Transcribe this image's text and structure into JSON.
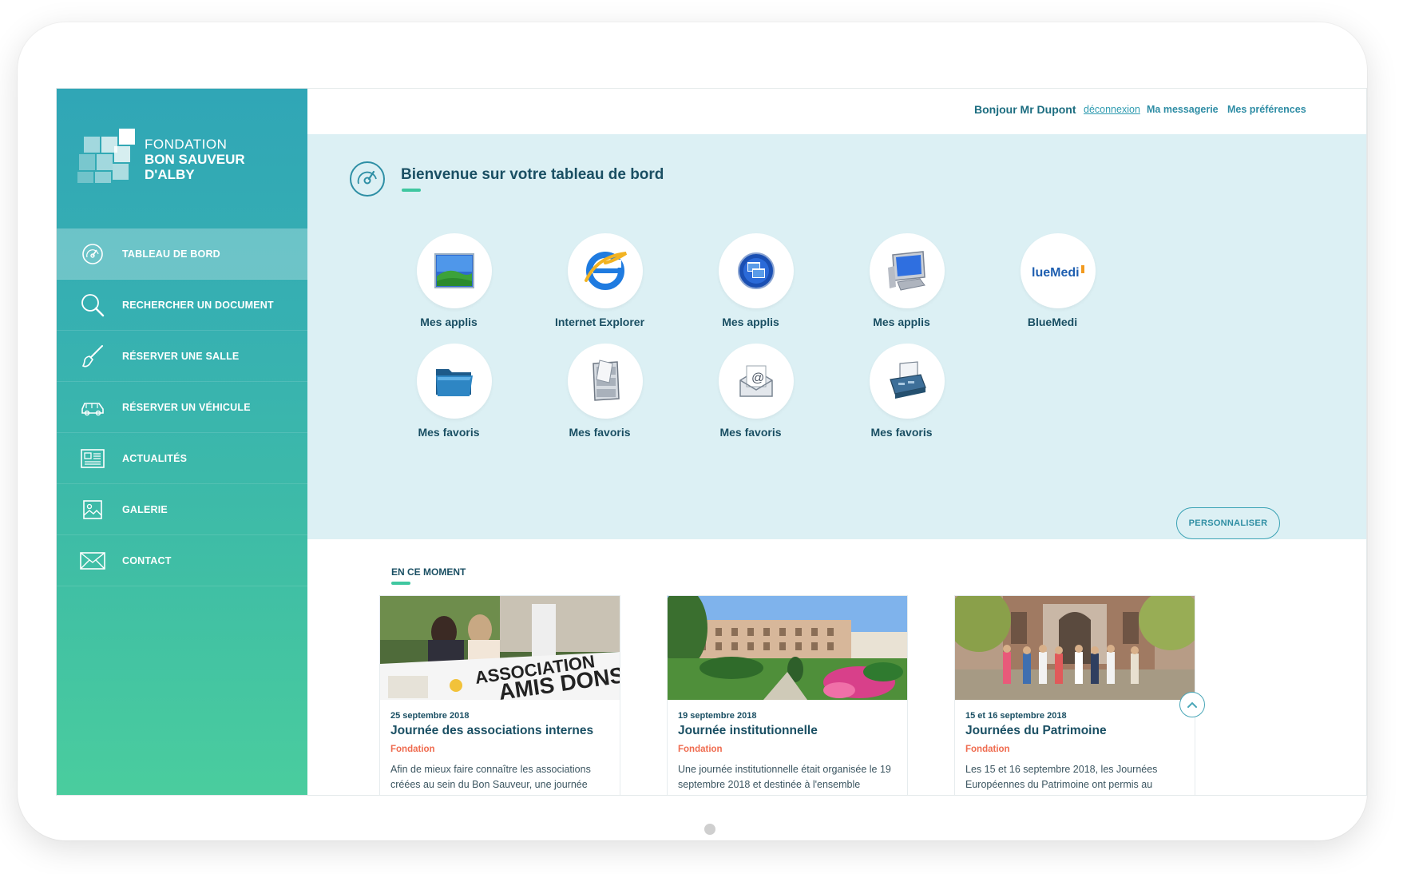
{
  "brand": {
    "line1": "FONDATION",
    "line2": "BON SAUVEUR",
    "line3": "D'ALBY"
  },
  "nav": {
    "items": [
      {
        "label": "TABLEAU DE BORD",
        "icon": "dashboard-gauge-icon",
        "active": true
      },
      {
        "label": "RECHERCHER UN DOCUMENT",
        "icon": "search-icon",
        "active": false
      },
      {
        "label": "RÉSERVER UNE SALLE",
        "icon": "brush-icon",
        "active": false
      },
      {
        "label": "RÉSERVER UN VÉHICULE",
        "icon": "car-icon",
        "active": false
      },
      {
        "label": "ACTUALITÉS",
        "icon": "newspaper-icon",
        "active": false
      },
      {
        "label": "GALERIE",
        "icon": "image-icon",
        "active": false
      },
      {
        "label": "CONTACT",
        "icon": "envelope-icon",
        "active": false
      }
    ]
  },
  "header": {
    "greeting": "Bonjour Mr Dupont",
    "logout": "déconnexion",
    "messaging": "Ma messagerie",
    "preferences": "Mes préférences"
  },
  "dashboard": {
    "title": "Bienvenue sur votre tableau de bord",
    "apps": [
      {
        "label": "Mes applis",
        "icon": "landscape-wallpaper-icon"
      },
      {
        "label": "Internet Explorer",
        "icon": "internet-explorer-icon"
      },
      {
        "label": "Mes applis",
        "icon": "remote-desktop-icon"
      },
      {
        "label": "Mes applis",
        "icon": "computer-monitor-icon"
      },
      {
        "label": "BlueMedi",
        "icon": "bluemedi-logo-icon",
        "logo_text": "lueMedi"
      },
      {
        "label": "Mes favoris",
        "icon": "folder-icon"
      },
      {
        "label": "Mes favoris",
        "icon": "file-cabinet-icon"
      },
      {
        "label": "Mes favoris",
        "icon": "email-envelope-icon"
      },
      {
        "label": "Mes favoris",
        "icon": "fax-printer-icon"
      }
    ],
    "customize_button": "PERSONNALISER"
  },
  "news": {
    "heading": "EN CE MOMENT",
    "articles": [
      {
        "date": "25 septembre 2018",
        "title": "Journée des associations internes",
        "category": "Fondation",
        "excerpt": "Afin de mieux faire connaître les associations créées au sein du Bon Sauveur, une journée",
        "image_text": "ASSOCIATION",
        "image_text2": "AMIS DONS"
      },
      {
        "date": "19 septembre 2018",
        "title": "Journée institutionnelle",
        "category": "Fondation",
        "excerpt": "Une journée institutionnelle était organisée le 19 septembre 2018 et destinée à l'ensemble"
      },
      {
        "date": "15 et 16 septembre 2018",
        "title": "Journées du Patrimoine",
        "category": "Fondation",
        "excerpt": "Les 15 et 16 septembre 2018, les Journées Européennes du Patrimoine ont permis au"
      }
    ]
  },
  "colors": {
    "accent": "#3fc7a0",
    "primary_text": "#1a4f63",
    "category": "#ef6b4f",
    "dashboard_bg": "#dcf0f4"
  }
}
